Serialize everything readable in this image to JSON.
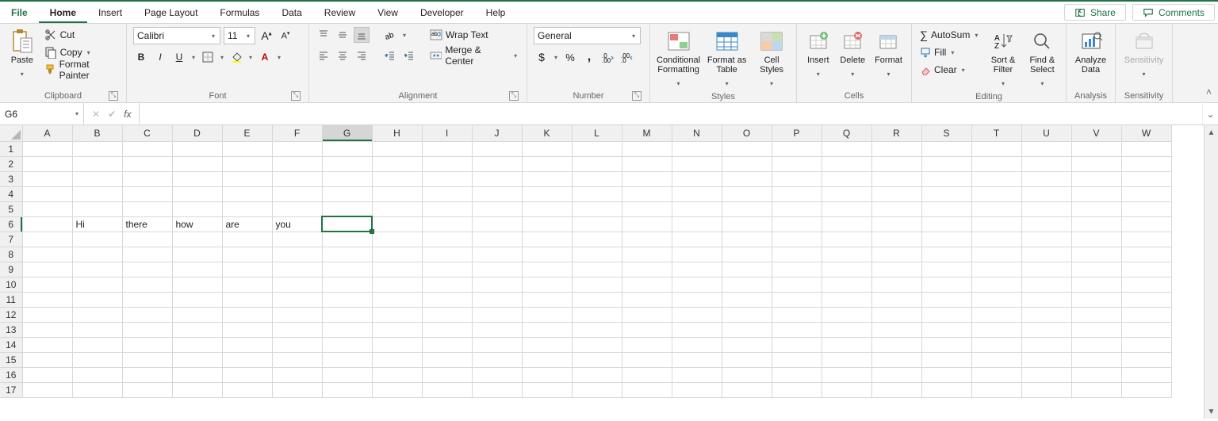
{
  "tabs": {
    "file": "File",
    "items": [
      "Home",
      "Insert",
      "Page Layout",
      "Formulas",
      "Data",
      "Review",
      "View",
      "Developer",
      "Help"
    ],
    "active": "Home",
    "share": "Share",
    "comments": "Comments"
  },
  "ribbon": {
    "clipboard": {
      "label": "Clipboard",
      "paste": "Paste",
      "cut": "Cut",
      "copy": "Copy",
      "format_painter": "Format Painter"
    },
    "font": {
      "label": "Font",
      "name": "Calibri",
      "size": "11"
    },
    "alignment": {
      "label": "Alignment",
      "wrap": "Wrap Text",
      "merge": "Merge & Center"
    },
    "number": {
      "label": "Number",
      "format": "General"
    },
    "styles": {
      "label": "Styles",
      "conditional": "Conditional Formatting",
      "format_table": "Format as Table",
      "cell_styles": "Cell Styles"
    },
    "cells": {
      "label": "Cells",
      "insert": "Insert",
      "delete": "Delete",
      "format": "Format"
    },
    "editing": {
      "label": "Editing",
      "autosum": "AutoSum",
      "fill": "Fill",
      "clear": "Clear",
      "sort": "Sort & Filter",
      "find": "Find & Select"
    },
    "analysis": {
      "label": "Analysis",
      "analyze": "Analyze Data"
    },
    "sensitivity": {
      "label": "Sensitivity",
      "btn": "Sensitivity"
    }
  },
  "fx": {
    "namebox": "G6",
    "formula": ""
  },
  "grid": {
    "columns": [
      "A",
      "B",
      "C",
      "D",
      "E",
      "F",
      "G",
      "H",
      "I",
      "J",
      "K",
      "L",
      "M",
      "N",
      "O",
      "P",
      "Q",
      "R",
      "S",
      "T",
      "U",
      "V",
      "W"
    ],
    "rows": 17,
    "active": {
      "col": "G",
      "row": 6
    },
    "cells": {
      "B6": "Hi",
      "C6": "there",
      "D6": "how",
      "E6": "are",
      "F6": "you"
    }
  }
}
